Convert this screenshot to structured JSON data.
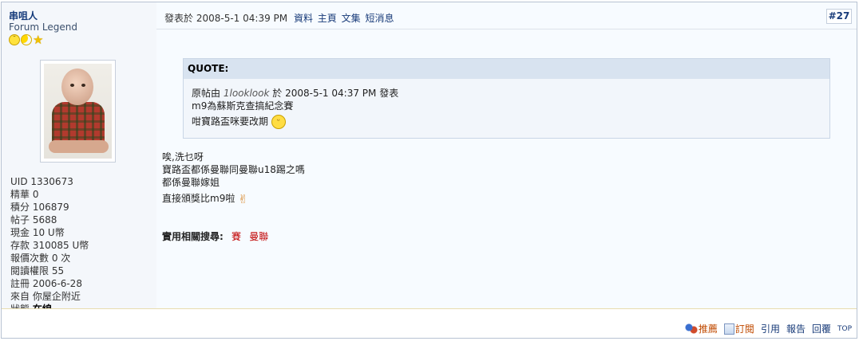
{
  "author": {
    "name": "串咀人",
    "title": "Forum Legend",
    "stats": [
      {
        "label": "UID",
        "value": "1330673"
      },
      {
        "label": "精華",
        "value": "0"
      },
      {
        "label": "積分",
        "value": "106879"
      },
      {
        "label": "帖子",
        "value": "5688"
      },
      {
        "label": "現金",
        "value": "10 U幣"
      },
      {
        "label": "存款",
        "value": "310085 U幣"
      },
      {
        "label": "報價次數",
        "value": "0 次"
      },
      {
        "label": "閱讀權限",
        "value": "55"
      },
      {
        "label": "註冊",
        "value": "2006-6-28"
      },
      {
        "label": "來自",
        "value": "你屋企附近"
      },
      {
        "label": "狀態",
        "value": "在線"
      }
    ]
  },
  "post": {
    "posted_prefix": "發表於",
    "posted_time": "2008-5-1 04:39 PM",
    "links": {
      "profile": "資料",
      "homepage": "主頁",
      "blog": "文集",
      "message": "短消息"
    },
    "floor": "#27"
  },
  "quote": {
    "header": "QUOTE:",
    "origin_prefix": "原帖由",
    "origin_user": "1looklook",
    "origin_mid": "於",
    "origin_time": "2008-5-1 04:37 PM",
    "origin_suffix": "發表",
    "line1": "m9為蘇斯克查搞紀念賽",
    "line2": "咁寶路盃咪要改期"
  },
  "content": {
    "lines": [
      "唉,洗乜呀",
      "寶路盃都係曼聯同曼聯u18踢之嗎",
      "都係曼聯嫁姐",
      "直接頒獎比m9啦"
    ]
  },
  "related": {
    "label": "實用相關搜尋:",
    "terms": [
      "賽",
      "曼聯"
    ]
  },
  "actions": {
    "recommend": "推薦",
    "subscribe": "訂閱",
    "quote": "引用",
    "report": "報告",
    "reply": "回覆",
    "top": "TOP"
  }
}
